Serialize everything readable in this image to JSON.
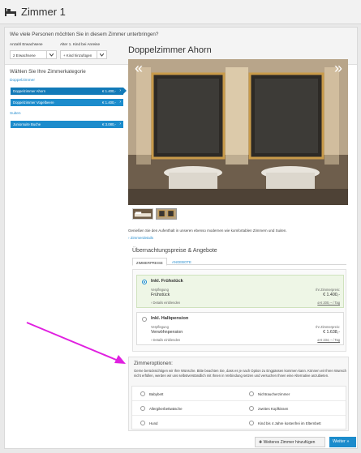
{
  "header": {
    "title": "Zimmer 1"
  },
  "guests": {
    "question": "Wie viele Personen möchten Sie in diesem Zimmer unterbringen?",
    "adults_label": "Anzahl Erwachsene",
    "adults_value": "2 Erwachsene",
    "child_label": "Alter 1. Kind bei Anreise",
    "child_value": "+ Kind hinzufügen"
  },
  "categories": {
    "heading": "Wählen Sie Ihre Zimmerkategorie",
    "groups": [
      {
        "name": "Doppelzimmer",
        "rooms": [
          {
            "name": "Doppelzimmer Ahorn",
            "price": "€ 1.400,-"
          },
          {
            "name": "Doppelzimmer Vogelbeere",
            "price": "€ 1.400,-"
          }
        ]
      },
      {
        "name": "Suiten",
        "rooms": [
          {
            "name": "Juniorsuite Buche",
            "price": "€ 3.080,-"
          }
        ]
      }
    ]
  },
  "room": {
    "title": "Doppelzimmer Ahorn",
    "nav_prev": "«",
    "nav_next": "»",
    "description": "Genießen Sie den Aufenthalt in unseren ebenso modernen wie komfortablen Zimmern und Suiten.",
    "details_link": "Zimmerdetails"
  },
  "rates": {
    "heading": "Übernachtungspreise & Angebote",
    "tab_rates": "ZIMMERPREISE",
    "tab_offers": "ANGEBOTE",
    "offers": [
      {
        "title": "Inkl. Frühstück",
        "board_label": "Verpflegung",
        "board_value": "Frühstück",
        "price_label": "Ihr Zimmerpreis:",
        "price": "€ 1.400,-",
        "details": "Details einblenden",
        "per_day": "ø € 200,-- / Tag"
      },
      {
        "title": "Inkl. Halbpension",
        "board_label": "Verpflegung",
        "board_value": "Verwöhnpension",
        "price_label": "Ihr Zimmerpreis:",
        "price": "€ 1.638,-",
        "details": "Details einblenden",
        "per_day": "ø € 234,-- / Tag"
      }
    ]
  },
  "options": {
    "heading": "Zimmeroptionen:",
    "text": "Gerne berücksichtigen wir Ihre Wünsche. Bitte beachten Sie, dass es je nach Option zu Engpässen kommen kann. Können wir Ihren Wunsch nicht erfüllen, werden wir uns selbstverständlich mit Ihnen in Verbindung setzen und versuchen Ihnen eine Alternative anzubieten.",
    "items": [
      "Babybett",
      "Nichtraucherzimmer",
      "Allergikerbettwäsche",
      "zweites Kopfkissen",
      "Hund",
      "Kind bis 4 Jahre kostenfrei im Elternbett"
    ]
  },
  "footer": {
    "add_room": "Weiteres Zimmer hinzufügen",
    "next": "Weiter"
  },
  "colors": {
    "accent": "#1c8ccc",
    "annotation_arrow": "#e020e0"
  }
}
